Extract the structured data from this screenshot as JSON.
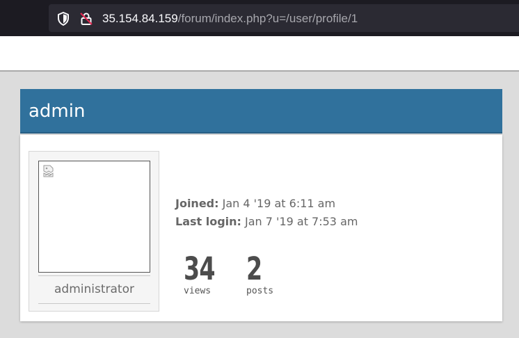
{
  "browser": {
    "url_host": "35.154.84.159",
    "url_path": "/forum/index.php?u=/user/profile/1",
    "icons": [
      "shield-icon",
      "insecure-lock-icon"
    ]
  },
  "profile": {
    "username": "admin",
    "role": "administrator",
    "joined_label": "Joined:",
    "joined_value": " Jan 4 '19 at 6:11 am",
    "last_login_label": "Last login:",
    "last_login_value": " Jan 7 '19 at 7:53 am",
    "avatar_icon": "broken-image-icon"
  },
  "stats": {
    "views_count": "34",
    "views_label": "views",
    "posts_count": "2",
    "posts_label": "posts"
  },
  "colors": {
    "header_bg": "#30719c",
    "page_bg": "#dcdcdc",
    "browser_bar": "#1c1b22"
  }
}
